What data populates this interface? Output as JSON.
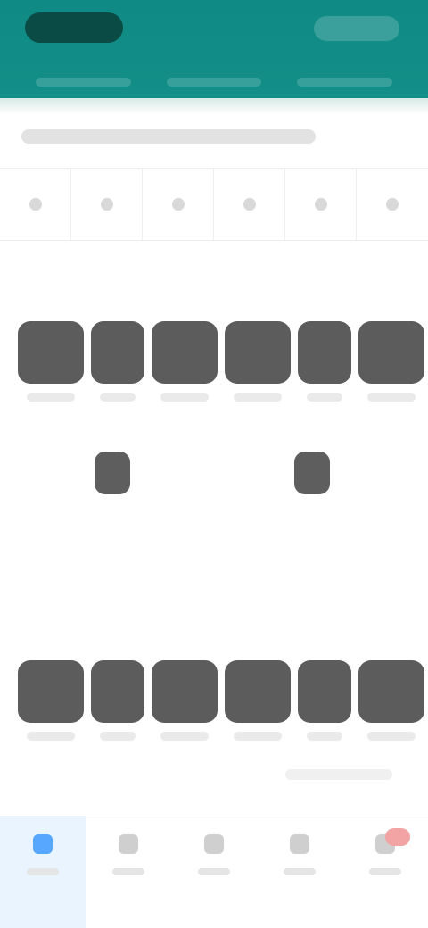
{
  "header": {
    "title": "",
    "action_label": "",
    "tabs": []
  },
  "section": {
    "title": ""
  },
  "date_strip": {
    "days": [
      "",
      "",
      "",
      "",
      "",
      ""
    ]
  },
  "grid": {
    "row1_labels": [
      "",
      "",
      "",
      "",
      "",
      ""
    ],
    "row2_labels": [
      "",
      "",
      "",
      "",
      "",
      ""
    ]
  },
  "footer": {
    "note": ""
  },
  "bottom_nav": {
    "items": [
      {
        "label": "",
        "icon": "home-icon"
      },
      {
        "label": "",
        "icon": "calendar-icon"
      },
      {
        "label": "",
        "icon": "chart-icon"
      },
      {
        "label": "",
        "icon": "user-icon"
      },
      {
        "label": "",
        "icon": "alert-icon"
      }
    ]
  },
  "colors": {
    "primary": "#138f88",
    "active_nav": "#57a6ff",
    "tile": "#5c5c5c",
    "alert": "#f2a3a3"
  }
}
